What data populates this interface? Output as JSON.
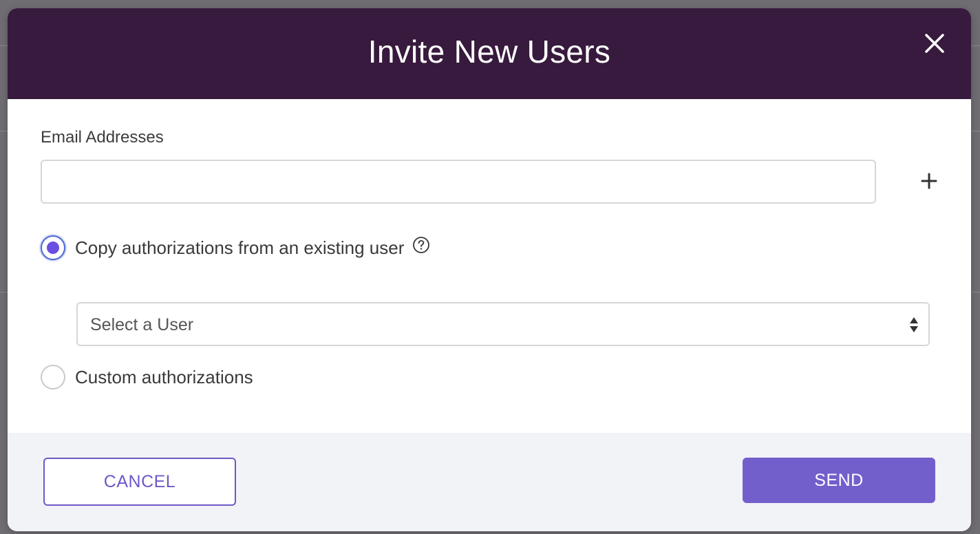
{
  "modal": {
    "title": "Invite New Users"
  },
  "email": {
    "label": "Email Addresses",
    "value": "",
    "placeholder": ""
  },
  "authorization": {
    "options": [
      {
        "label": "Copy authorizations from an existing user",
        "checked": true
      },
      {
        "label": "Custom authorizations",
        "checked": false
      }
    ],
    "user_select": {
      "selected": "Select a User"
    }
  },
  "footer": {
    "cancel_label": "CANCEL",
    "send_label": "SEND"
  },
  "icons": {
    "close": "close-icon",
    "add": "plus-icon",
    "help": "question-circle-icon",
    "select": "up-down-arrows-icon"
  },
  "colors": {
    "header_bg": "#371a3d",
    "accent": "#735fcc",
    "radio_selected": "#6b4fe0",
    "footer_bg": "#f2f3f7"
  }
}
